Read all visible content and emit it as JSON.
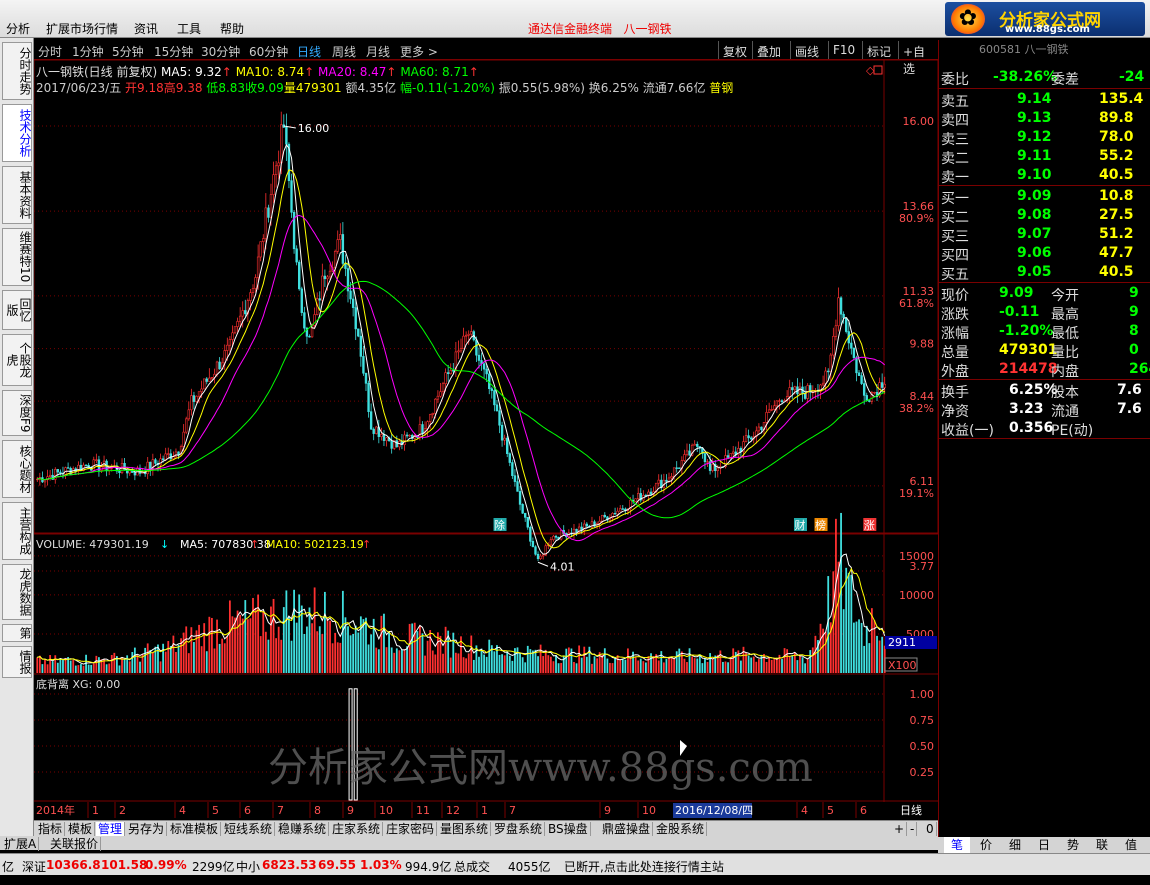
{
  "menu": {
    "items": [
      "分析",
      "扩展市场行情",
      "资讯",
      "工具",
      "帮助"
    ],
    "title": "通达信金融终端",
    "stock": "八一钢铁"
  },
  "logo": {
    "brand": "分析家公式网",
    "url": "www.88gs.com"
  },
  "left_tabs": [
    "分时走势",
    "技术分析",
    "基本资料",
    "维赛特10",
    "回忆版",
    "个股龙虎",
    "深度F9",
    "核心题材",
    "主营构成",
    "龙虎数据",
    "第",
    "情报"
  ],
  "toolbar": {
    "periods": [
      "分时",
      "1分钟",
      "5分钟",
      "15分钟",
      "30分钟",
      "60分钟",
      "日线",
      "周线",
      "月线",
      "更多 >"
    ],
    "active_period": "日线",
    "right_buttons": [
      "复权",
      "叠加",
      "画线",
      "F10",
      "标记",
      "+自选"
    ]
  },
  "chart_header": {
    "name": "八一钢铁(日线 前复权)",
    "ma5": "MA5: 9.32",
    "ma10": "MA10: 8.74",
    "ma20": "MA20: 8.47",
    "ma60": "MA60: 8.71",
    "date": "2017/06/23/五",
    "open": "开9.18",
    "high": "高9.38",
    "low": "低8.83",
    "close": "收9.09",
    "volume": "量479301",
    "amount": "额4.35亿",
    "change": "幅-0.11(-1.20%)",
    "amplitude": "振0.55(5.98%)",
    "turnover": "换6.25%",
    "float": "流通7.66亿",
    "sector": "普钢"
  },
  "volume_header": {
    "label": "VOLUME: 479301.19",
    "ma5": "MA5: 707830.38",
    "ma10": "MA10: 502123.19"
  },
  "indicator_header": {
    "label": "底背离 XG: 0.00"
  },
  "price_axis": [
    {
      "v": "16.00",
      "pct": ""
    },
    {
      "v": "13.66",
      "pct": "80.9%"
    },
    {
      "v": "11.33",
      "pct": "61.8%"
    },
    {
      "v": "9.88",
      "pct": ""
    },
    {
      "v": "8.44",
      "pct": "38.2%"
    },
    {
      "v": "6.11",
      "pct": "19.1%"
    },
    {
      "v": "3.77",
      "pct": ""
    }
  ],
  "volume_axis": [
    "15000",
    "10000",
    "5000"
  ],
  "volume_marker": "2911",
  "volume_unit": "X100",
  "indicator_axis": [
    "1.00",
    "0.75",
    "0.50",
    "0.25"
  ],
  "time_axis": {
    "year": "2014年",
    "months": [
      "1",
      "2",
      "4",
      "5",
      "6",
      "7",
      "8",
      "9",
      "10",
      "11",
      "12",
      "1",
      "7",
      "8",
      "9",
      "10",
      "4",
      "5",
      "6"
    ],
    "highlight": "2016/12/08/四",
    "period_label": "日线"
  },
  "annotations": {
    "high": "16.00",
    "low": "4.01",
    "tags": [
      "除",
      "财",
      "榜",
      "涨"
    ]
  },
  "chart_data": {
    "type": "candlestick",
    "ylim": [
      3.77,
      16.0
    ],
    "series": [
      "MA5",
      "MA10",
      "MA20",
      "MA60"
    ],
    "anchors": [
      [
        0,
        6.3
      ],
      [
        20,
        6.7
      ],
      [
        40,
        6.5
      ],
      [
        55,
        7.1
      ],
      [
        60,
        8.4
      ],
      [
        75,
        9.9
      ],
      [
        85,
        11.9
      ],
      [
        92,
        14.6
      ],
      [
        96,
        16.0
      ],
      [
        102,
        11.3
      ],
      [
        106,
        10.1
      ],
      [
        112,
        12.0
      ],
      [
        118,
        12.8
      ],
      [
        125,
        10.3
      ],
      [
        130,
        7.8
      ],
      [
        140,
        7.2
      ],
      [
        150,
        7.7
      ],
      [
        158,
        8.9
      ],
      [
        168,
        10.3
      ],
      [
        175,
        9.0
      ],
      [
        180,
        7.8
      ],
      [
        188,
        5.6
      ],
      [
        195,
        4.01
      ],
      [
        200,
        4.7
      ],
      [
        215,
        5.0
      ],
      [
        230,
        5.6
      ],
      [
        245,
        6.3
      ],
      [
        258,
        7.3
      ],
      [
        262,
        6.5
      ],
      [
        270,
        6.9
      ],
      [
        280,
        7.6
      ],
      [
        290,
        8.6
      ],
      [
        300,
        8.7
      ],
      [
        308,
        9.1
      ],
      [
        312,
        11.3
      ],
      [
        318,
        9.6
      ],
      [
        322,
        8.6
      ],
      [
        326,
        8.7
      ],
      [
        330,
        9.09
      ]
    ],
    "volume_anchors": [
      [
        0,
        1500
      ],
      [
        30,
        1800
      ],
      [
        50,
        3000
      ],
      [
        60,
        4500
      ],
      [
        70,
        6000
      ],
      [
        90,
        7000
      ],
      [
        100,
        8000
      ],
      [
        115,
        7500
      ],
      [
        125,
        6500
      ],
      [
        140,
        4500
      ],
      [
        160,
        4000
      ],
      [
        175,
        3000
      ],
      [
        195,
        2500
      ],
      [
        220,
        2300
      ],
      [
        250,
        2100
      ],
      [
        280,
        2300
      ],
      [
        300,
        2000
      ],
      [
        308,
        9000
      ],
      [
        312,
        15000
      ],
      [
        316,
        10000
      ],
      [
        322,
        5000
      ],
      [
        326,
        8000
      ],
      [
        330,
        4800
      ]
    ],
    "signals": [
      122,
      124
    ]
  },
  "right_panel": {
    "code": "600581 八一钢铁",
    "weibi_label": "委比",
    "weibi": "-38.26%",
    "weicha_label": "委差",
    "weicha": "-24",
    "asks": [
      {
        "label": "卖五",
        "price": "9.14",
        "vol": "135.4"
      },
      {
        "label": "卖四",
        "price": "9.13",
        "vol": "89.8"
      },
      {
        "label": "卖三",
        "price": "9.12",
        "vol": "78.0"
      },
      {
        "label": "卖二",
        "price": "9.11",
        "vol": "55.2"
      },
      {
        "label": "卖一",
        "price": "9.10",
        "vol": "40.5"
      }
    ],
    "bids": [
      {
        "label": "买一",
        "price": "9.09",
        "vol": "10.8"
      },
      {
        "label": "买二",
        "price": "9.08",
        "vol": "27.5"
      },
      {
        "label": "买三",
        "price": "9.07",
        "vol": "51.2"
      },
      {
        "label": "买四",
        "price": "9.06",
        "vol": "47.7"
      },
      {
        "label": "买五",
        "price": "9.05",
        "vol": "40.5"
      }
    ],
    "stats": [
      {
        "l1": "现价",
        "v1": "9.09",
        "l2": "今开",
        "v2": "9"
      },
      {
        "l1": "涨跌",
        "v1": "-0.11",
        "l2": "最高",
        "v2": "9"
      },
      {
        "l1": "涨幅",
        "v1": "-1.20%",
        "l2": "最低",
        "v2": "8"
      },
      {
        "l1": "总量",
        "v1": "479301",
        "l2": "量比",
        "v2": "0"
      },
      {
        "l1": "外盘",
        "v1": "214478",
        "l2": "内盘",
        "v2": "2648"
      }
    ],
    "fund": [
      {
        "l1": "换手",
        "v1": "6.25%",
        "l2": "股本",
        "v2": "7.6"
      },
      {
        "l1": "净资",
        "v1": "3.23",
        "l2": "流通",
        "v2": "7.6"
      },
      {
        "l1": "收益(一)",
        "v1": "0.356",
        "l2": "PE(动)",
        "v2": ""
      }
    ],
    "bottom_buttons": [
      "笔",
      "价",
      "细",
      "日",
      "势",
      "联",
      "值"
    ]
  },
  "bottom_tabs": [
    "指标",
    "模板",
    "管理",
    "另存为",
    "标准模板",
    "短线系统",
    "稳赚系统",
    "庄家系统",
    "庄家密码",
    "量图系统",
    "罗盘系统",
    "BS操盘",
    "鼎盛操盘",
    "金股系统"
  ],
  "active_bottom_tab": "管理",
  "bottom_tabs2": [
    "扩展A",
    "关联报价"
  ],
  "bottom_ctrl": [
    "+",
    "-",
    "0"
  ],
  "status": {
    "unit": "亿",
    "shenzhen_label": "深证",
    "shenzhen": "10366.8",
    "shenzhen_chg": "101.58",
    "shenzhen_pct": "0.99%",
    "shenzhen_amt": "2299亿",
    "zx_label": "中小",
    "zx": "6823.53",
    "zx_chg": "69.55",
    "zx_pct": "1.03%",
    "zx_amt": "994.9亿",
    "total_label": "总成交",
    "total": "4055亿",
    "conn": "已断开,点击此处连接行情主站"
  },
  "watermark": "分析家公式网www.88gs.com",
  "colors": {
    "up": "#ff3030",
    "down": "#40e0e0",
    "ma5": "#ffffff",
    "ma10": "#ffff00",
    "ma20": "#ff00ff",
    "ma60": "#00ff00",
    "grid": "#7a0000"
  }
}
